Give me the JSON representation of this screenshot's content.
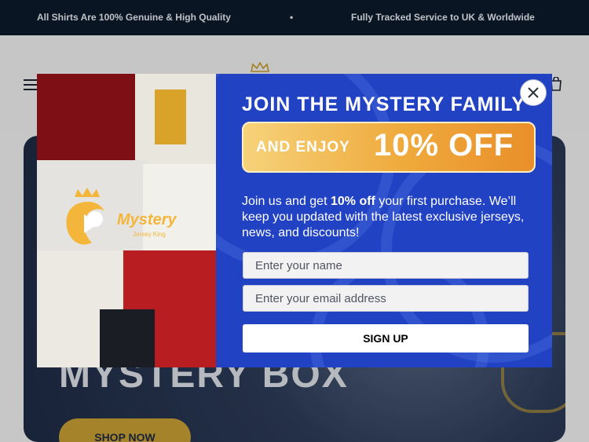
{
  "announcement": {
    "left": "All Shirts Are 100% Genuine & High Quality",
    "separator": "•",
    "right": "Fully Tracked Service to UK & Worldwide"
  },
  "hero": {
    "title": "MYSTERY BOX",
    "button": "SHOP NOW"
  },
  "modal": {
    "brand": {
      "name": "Mystery",
      "tagline": "Jersey King"
    },
    "title": "JOIN THE MYSTERY FAMILY",
    "promo_small": "AND ENJOY",
    "promo_big": "10% OFF",
    "body_before": "Join us and get ",
    "body_bold": "10% off",
    "body_after": " your first purchase. We’ll keep you updated with the latest exclusive jerseys, news, and discounts!",
    "name_placeholder": "Enter your name",
    "email_placeholder": "Enter your email address",
    "submit": "SIGN UP"
  },
  "icons": {
    "menu": "hamburger-icon",
    "logo": "crown-icon",
    "cart": "bag-icon",
    "close": "close-icon"
  },
  "colors": {
    "topbar": "#0d1a2b",
    "modal_blue": "#2242c4",
    "promo_orange": "#efaa3c",
    "gold": "#c9a035"
  }
}
